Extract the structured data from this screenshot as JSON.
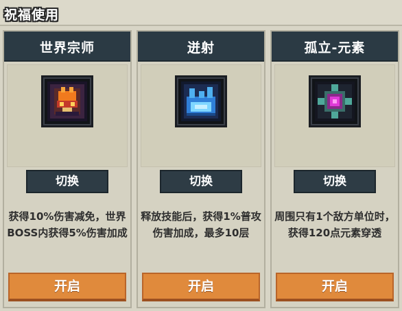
{
  "header": {
    "title": "祝福使用"
  },
  "cards": [
    {
      "title": "世界宗师",
      "icon": "master-flame-icon",
      "switch_label": "切换",
      "description": "获得10%伤害减免，世界BOSS内获得5%伤害加成",
      "open_label": "开启"
    },
    {
      "title": "迸射",
      "icon": "burst-crystal-icon",
      "switch_label": "切换",
      "description": "释放技能后，获得1%普攻伤害加成，最多10层",
      "open_label": "开启"
    },
    {
      "title": "孤立-元素",
      "icon": "isolated-element-orb-icon",
      "switch_label": "切换",
      "description": "周围只有1个敌方单位时，获得120点元素穿透",
      "open_label": "开启"
    }
  ],
  "colors": {
    "card_header": "#2b3a44",
    "open_button": "#e08a3c",
    "switch_button": "#2e3c45"
  }
}
